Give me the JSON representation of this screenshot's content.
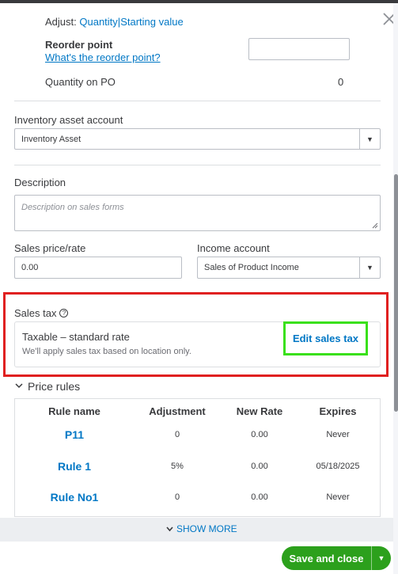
{
  "adjust": {
    "prefix": "Adjust:",
    "quantity_link": "Quantity",
    "separator": "|",
    "starting_link": "Starting value"
  },
  "reorder": {
    "label": "Reorder point",
    "help_link": "What's the reorder point?",
    "value": ""
  },
  "quantity_po": {
    "label": "Quantity on PO",
    "value": "0"
  },
  "inventory_account": {
    "label": "Inventory asset account",
    "value": "Inventory Asset"
  },
  "description": {
    "label": "Description",
    "placeholder": "Description on sales forms"
  },
  "sales_price": {
    "label": "Sales price/rate",
    "value": "0.00"
  },
  "income_account": {
    "label": "Income account",
    "value": "Sales of Product Income"
  },
  "sales_tax": {
    "label": "Sales tax",
    "help_icon": "?",
    "title": "Taxable – standard rate",
    "subtitle": "We'll apply sales tax based on location only.",
    "edit_label": "Edit sales tax"
  },
  "price_rules": {
    "title": "Price rules",
    "headers": [
      "Rule name",
      "Adjustment",
      "New Rate",
      "Expires"
    ],
    "rows": [
      {
        "name": "P11",
        "adjustment": "0",
        "new_rate": "0.00",
        "expires": "Never"
      },
      {
        "name": "Rule 1",
        "adjustment": "5%",
        "new_rate": "0.00",
        "expires": "05/18/2025"
      },
      {
        "name": "Rule No1",
        "adjustment": "0",
        "new_rate": "0.00",
        "expires": "Never"
      }
    ],
    "show_more": "SHOW MORE"
  },
  "footer": {
    "save_close": "Save and close"
  },
  "icons": {
    "close": "close-icon",
    "caret": "caret-down-icon",
    "chevron": "chevron-down-icon"
  },
  "colors": {
    "link": "#0077c5",
    "highlight_red": "#e02020",
    "highlight_green": "#39e019",
    "save_green": "#2ca01c"
  }
}
